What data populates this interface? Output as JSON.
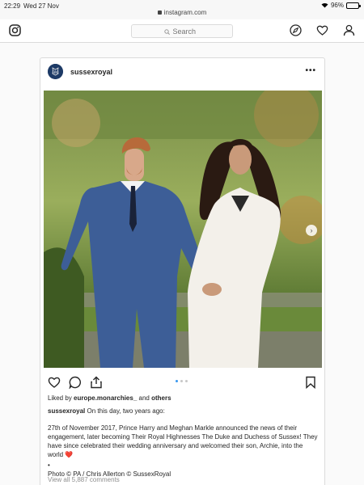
{
  "status_bar": {
    "time": "22:29",
    "date": "Wed 27 Nov",
    "url": "instagram.com",
    "battery": "96%"
  },
  "nav": {
    "search_placeholder": "Search",
    "icons": [
      "instagram-logo-icon",
      "compass-icon",
      "heart-icon",
      "profile-icon"
    ]
  },
  "post": {
    "username": "sussexroyal",
    "more_label": "•••",
    "carousel_pages": 3,
    "carousel_active": 0,
    "likes_prefix": "Liked by",
    "liked_by_user": "europe.monarchies_",
    "likes_and": "and",
    "likes_others": "others",
    "caption_intro": "On this day, two years ago:",
    "caption_body": "27th of November 2017, Prince Harry and Meghan Markle announced the news of their engagement, later becoming Their Royal Highnesses The Duke and Duchess of Sussex! They have since celebrated their wedding anniversary and welcomed their son, Archie, into the world ❤️",
    "caption_bullet": "•",
    "caption_credit": "Photo © PA / Chris Allerton © SussexRoyal",
    "comments_link": "View all 5,887 comments"
  },
  "colors": {
    "accent": "#3897f0",
    "border": "#dbdbdb",
    "muted": "#8e8e8e"
  }
}
